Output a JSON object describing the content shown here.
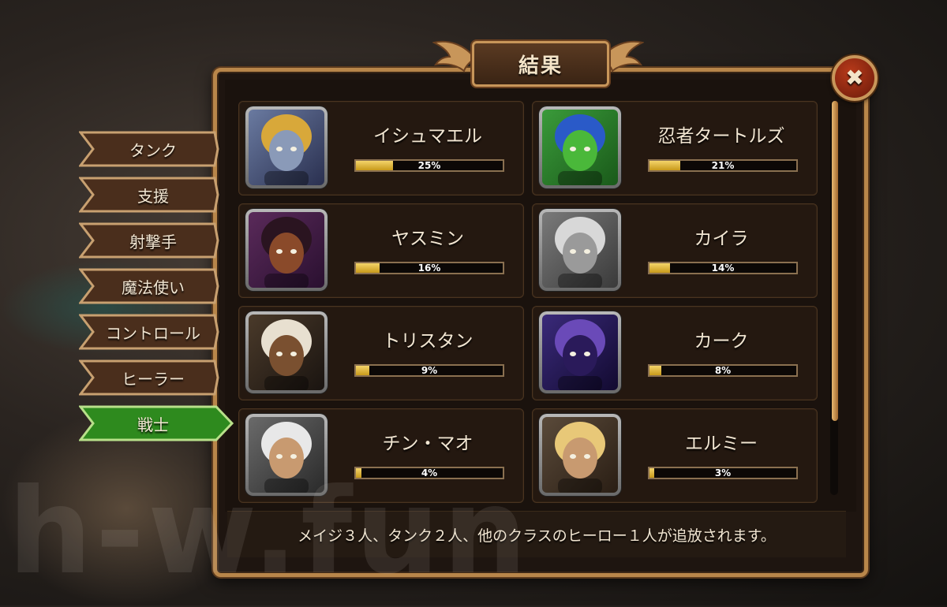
{
  "title": "結果",
  "close_symbol": "✖",
  "tabs": [
    {
      "label": "タンク",
      "active": false
    },
    {
      "label": "支援",
      "active": false
    },
    {
      "label": "射撃手",
      "active": false
    },
    {
      "label": "魔法使い",
      "active": false
    },
    {
      "label": "コントロール",
      "active": false
    },
    {
      "label": "ヒーラー",
      "active": false
    },
    {
      "label": "戦士",
      "active": true
    }
  ],
  "heroes": [
    {
      "name": "イシュマエル",
      "percent_label": "25%",
      "percent": 25
    },
    {
      "name": "忍者タートルズ",
      "percent_label": "21%",
      "percent": 21
    },
    {
      "name": "ヤスミン",
      "percent_label": "16%",
      "percent": 16
    },
    {
      "name": "カイラ",
      "percent_label": "14%",
      "percent": 14
    },
    {
      "name": "トリスタン",
      "percent_label": "9%",
      "percent": 9
    },
    {
      "name": "カーク",
      "percent_label": "8%",
      "percent": 8
    },
    {
      "name": "チン・マオ",
      "percent_label": "4%",
      "percent": 4
    },
    {
      "name": "エルミー",
      "percent_label": "3%",
      "percent": 3
    }
  ],
  "footer_text": "メイジ３人、タンク２人、他のクラスのヒーロー１人が追放されます。",
  "watermark": "h-w.fun",
  "colors": {
    "tab_inactive": "#4a2e1c",
    "tab_active": "#2e8a1e",
    "bar_fill": "#e8c040",
    "frame_gold": "#b8864a"
  }
}
